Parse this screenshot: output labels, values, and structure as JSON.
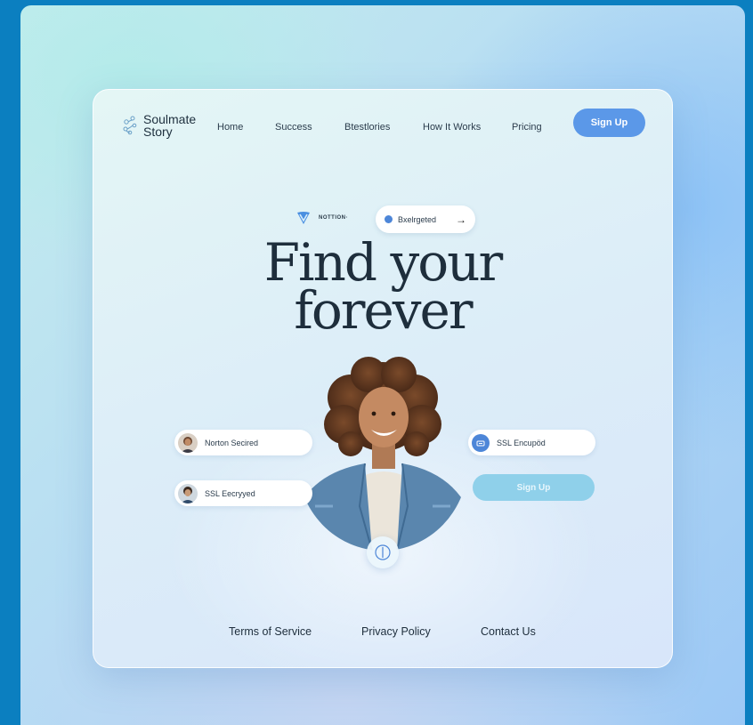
{
  "brand": {
    "line1": "Soulmate",
    "line2": "Story"
  },
  "nav": {
    "items": [
      "Home",
      "Success",
      "Btestlories",
      "How It Works",
      "Pricing"
    ],
    "signup_label": "Sign Up"
  },
  "badges": {
    "notion": "NOTTION·",
    "pill_label": "Bxelrgeted",
    "pill_arrow": "→"
  },
  "hero": {
    "line1": "Find your",
    "line2": "forever"
  },
  "chips": {
    "left1": "Norton Secired",
    "left2": "SSL Eecryyed",
    "right1": "SSL Encupöd",
    "signup_label": "Sign Up"
  },
  "footer": {
    "links": [
      "Terms of Service",
      "Privacy Policy",
      "Contact Us"
    ]
  },
  "colors": {
    "accent": "#5b98e8",
    "light_accent": "#8fd0ea",
    "heading": "#1e2e3c",
    "backdrop": "#0b7fc0"
  },
  "icons": [
    "logo-icon",
    "heart-shield-icon",
    "dot-icon",
    "arrow-right-icon",
    "lock-icon",
    "scroll-indicator-icon"
  ]
}
